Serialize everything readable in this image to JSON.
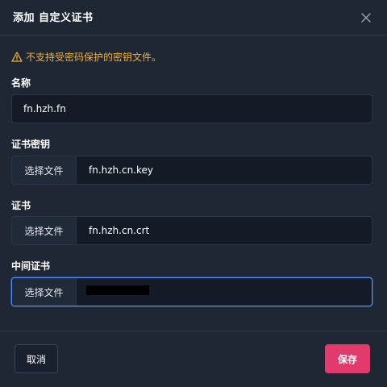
{
  "dialog": {
    "title": "添加 自定义证书",
    "warning": "不支持受密码保护的密钥文件。"
  },
  "fields": {
    "name_label": "名称",
    "name_value": "fn.hzh.fn",
    "key_label": "证书密钥",
    "key_button": "选择文件",
    "key_file": "fn.hzh.cn.key",
    "cert_label": "证书",
    "cert_button": "选择文件",
    "cert_file": "fn.hzh.cn.crt",
    "chain_label": "中间证书",
    "chain_button": "选择文件"
  },
  "footer": {
    "cancel_label": "取消",
    "save_label": "保存"
  },
  "colors": {
    "background": "#1f2735",
    "input_bg": "#141b27",
    "warning": "#f0b232",
    "primary": "#e23a6c",
    "focus": "#4a90ff"
  },
  "icons": {
    "close": "close-icon",
    "warning": "warning-icon"
  }
}
